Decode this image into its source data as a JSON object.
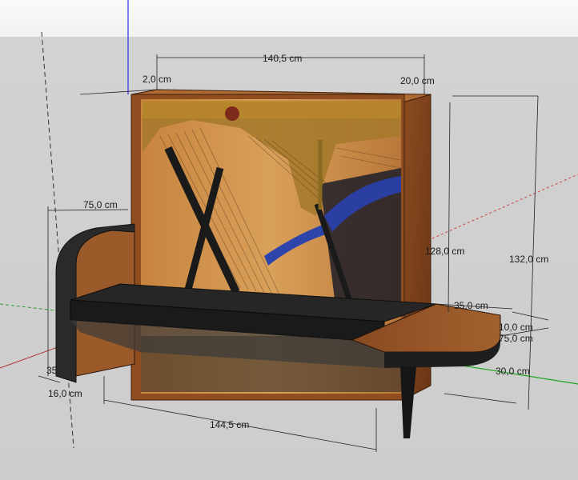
{
  "dimensions": {
    "top_width": "140,5 cm",
    "frame_left": "2,0 cm",
    "frame_right": "20,0 cm",
    "bench_depth": "75,0 cm",
    "inner_height": "128,0 cm",
    "total_height": "132,0 cm",
    "side_depth": "35,0 cm",
    "shelf_thickness": "10,0 cm",
    "shelf_height": "75,0 cm",
    "shelf_width": "30,0 cm",
    "bench_length": "144,5 cm",
    "left_thickness": "16,0 cm",
    "left_clip": "35",
    "bench_edge": "10,0 cm"
  },
  "colors": {
    "wood": "#9a5a2a",
    "bench_top": "#252525",
    "harp_gold": "#b8862a"
  }
}
